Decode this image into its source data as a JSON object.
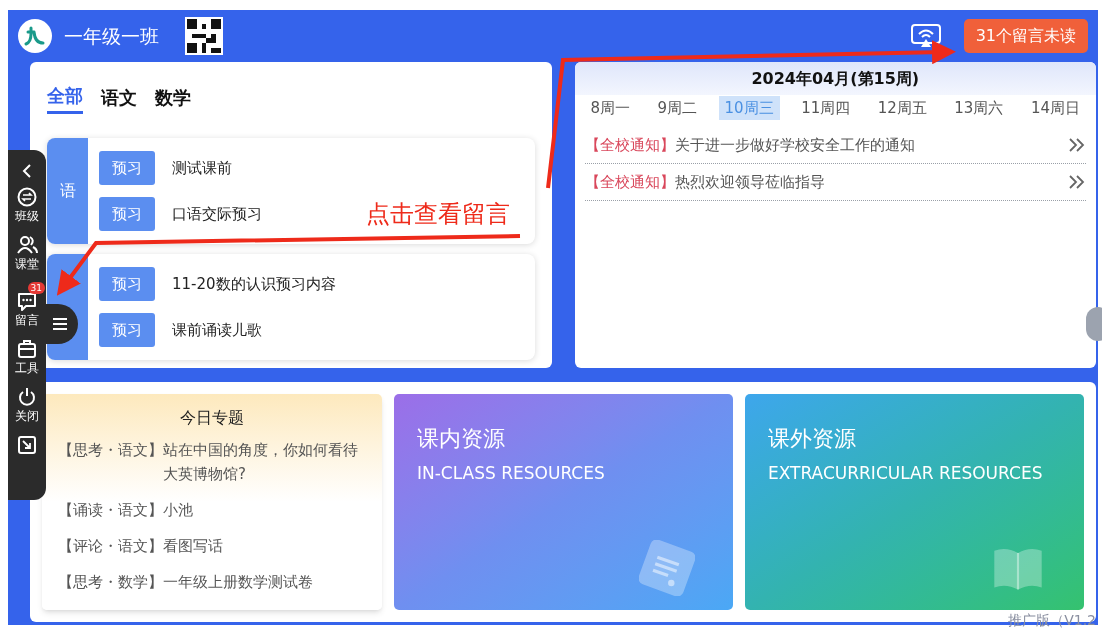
{
  "header": {
    "class_name": "一年级一班",
    "unread_button": "31个留言未读"
  },
  "tabs": [
    {
      "label": "全部",
      "selected": true
    },
    {
      "label": "语文",
      "selected": false
    },
    {
      "label": "数学",
      "selected": false
    }
  ],
  "lesson_groups": [
    {
      "subject": "语",
      "items": [
        {
          "tag": "预习",
          "title": "测试课前"
        },
        {
          "tag": "预习",
          "title": "口语交际预习"
        }
      ]
    },
    {
      "items": [
        {
          "tag": "预习",
          "title": "11-20数的认识预习内容"
        },
        {
          "tag": "预习",
          "title": "课前诵读儿歌"
        }
      ]
    }
  ],
  "calendar": {
    "title": "2024年04月(第15周)",
    "days": [
      {
        "label": "8周一",
        "selected": false
      },
      {
        "label": "9周二",
        "selected": false
      },
      {
        "label": "10周三",
        "selected": true
      },
      {
        "label": "11周四",
        "selected": false
      },
      {
        "label": "12周五",
        "selected": false
      },
      {
        "label": "13周六",
        "selected": false
      },
      {
        "label": "14周日",
        "selected": false
      }
    ],
    "notices": [
      {
        "tag": "【全校通知】",
        "text": "关于进一步做好学校安全工作的通知"
      },
      {
        "tag": "【全校通知】",
        "text": "热烈欢迎领导莅临指导"
      }
    ]
  },
  "topics": {
    "title": "今日专题",
    "items": [
      {
        "tag": "【思考・语文】",
        "text": "站在中国的角度，你如何看待大英博物馆?"
      },
      {
        "tag": "【诵读・语文】",
        "text": "小池"
      },
      {
        "tag": "【评论・语文】",
        "text": "看图写话"
      },
      {
        "tag": "【思考・数学】",
        "text": "一年级上册数学测试卷"
      }
    ]
  },
  "resources": [
    {
      "kind": "in_class",
      "title": "课内资源",
      "subtitle": "IN-CLASS RESOURCES"
    },
    {
      "kind": "extra",
      "title": "课外资源",
      "subtitle": "EXTRACURRICULAR RESOURCES"
    }
  ],
  "sidebar": {
    "items": [
      {
        "kind": "back"
      },
      {
        "kind": "class",
        "label": "班级"
      },
      {
        "kind": "classroom",
        "label": "课堂"
      },
      {
        "kind": "message",
        "label": "留言",
        "badge": "31"
      },
      {
        "kind": "tools",
        "label": "工具"
      },
      {
        "kind": "power",
        "label": "关闭"
      },
      {
        "kind": "minimize"
      }
    ]
  },
  "annotation": {
    "text": "点击查看留言"
  },
  "version": "推广版（V1.2"
}
